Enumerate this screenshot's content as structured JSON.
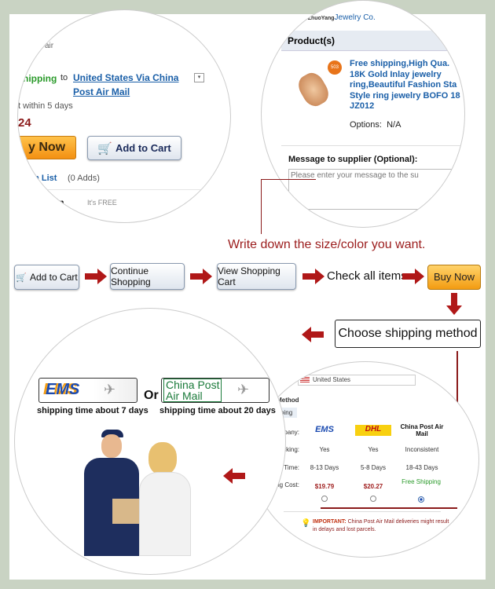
{
  "top_left": {
    "air_fragment": "air",
    "shipping_label": "hipping",
    "to": "to",
    "destination_link": "United States Via China",
    "destination_link_2": "Post Air Mail",
    "ship_within": "t within 5 days",
    "price_fragment": "24",
    "buy_now": "y Now",
    "add_to_cart": "Add to Cart",
    "wish_list": "sh List",
    "wish_count": "(0 Adds)",
    "protection": "tion",
    "its_free": "It's FREE",
    "orders_fragment": "rs"
  },
  "top_right": {
    "supplier_label": "ier:",
    "supplier_brand": "ZhuoYang",
    "supplier_name": "Jewelry Co.",
    "products_header": "Product(s)",
    "badge": "503",
    "product_title": [
      "Free shipping,High Qua.",
      "18K Gold Inlay jewelry",
      "ring,Beautiful Fashion Sta",
      "Style ring jewelry BOFO 18",
      "JZ012"
    ],
    "options_label": "Options:",
    "options_value": "N/A",
    "message_label": "Message to supplier (Optional):",
    "message_placeholder": "Please enter your message to the su"
  },
  "annotation": "Write down the size/color you want.",
  "flow": {
    "add_to_cart": "Add to Cart",
    "continue_shopping": "Continue Shopping",
    "view_cart": "View Shopping Cart",
    "check_items": "Check all items",
    "buy_now": "Buy Now",
    "choose_shipping": "Choose shipping method"
  },
  "bottom_left": {
    "ems_logo": "EMS",
    "or": "Or",
    "china_post_logo_1": "China Post",
    "china_post_logo_2": "Air Mail",
    "ems_time": "shipping time about 7 days",
    "china_post_time": "shipping time about 20 days"
  },
  "bottom_right": {
    "country": "United States",
    "method_header": "ping Method",
    "tab": "Shipping",
    "row_labels": [
      "pping Company:",
      "Tracking:",
      "Total Time:",
      "Shipping Cost:"
    ],
    "companies": [
      {
        "name": "EMS",
        "tracking": "Yes",
        "time": "8-13 Days",
        "cost": "$19.79",
        "selected": false
      },
      {
        "name": "DHL",
        "tracking": "Yes",
        "time": "5-8 Days",
        "cost": "$20.27",
        "selected": false
      },
      {
        "name": "China Post Air Mail",
        "tracking": "Inconsistent",
        "time": "18-43 Days",
        "cost": "Free Shipping",
        "selected": true
      }
    ],
    "important_label": "IMPORTANT:",
    "important_text": "China Post Air Mail deliveries might result",
    "important_text_2": "in delays and lost parcels."
  },
  "colors": {
    "arrow": "#b01818",
    "annotation": "#9b1c1c",
    "link": "#1a5fa8",
    "buy_now": "#f5a623",
    "green": "#2a9a2a"
  }
}
